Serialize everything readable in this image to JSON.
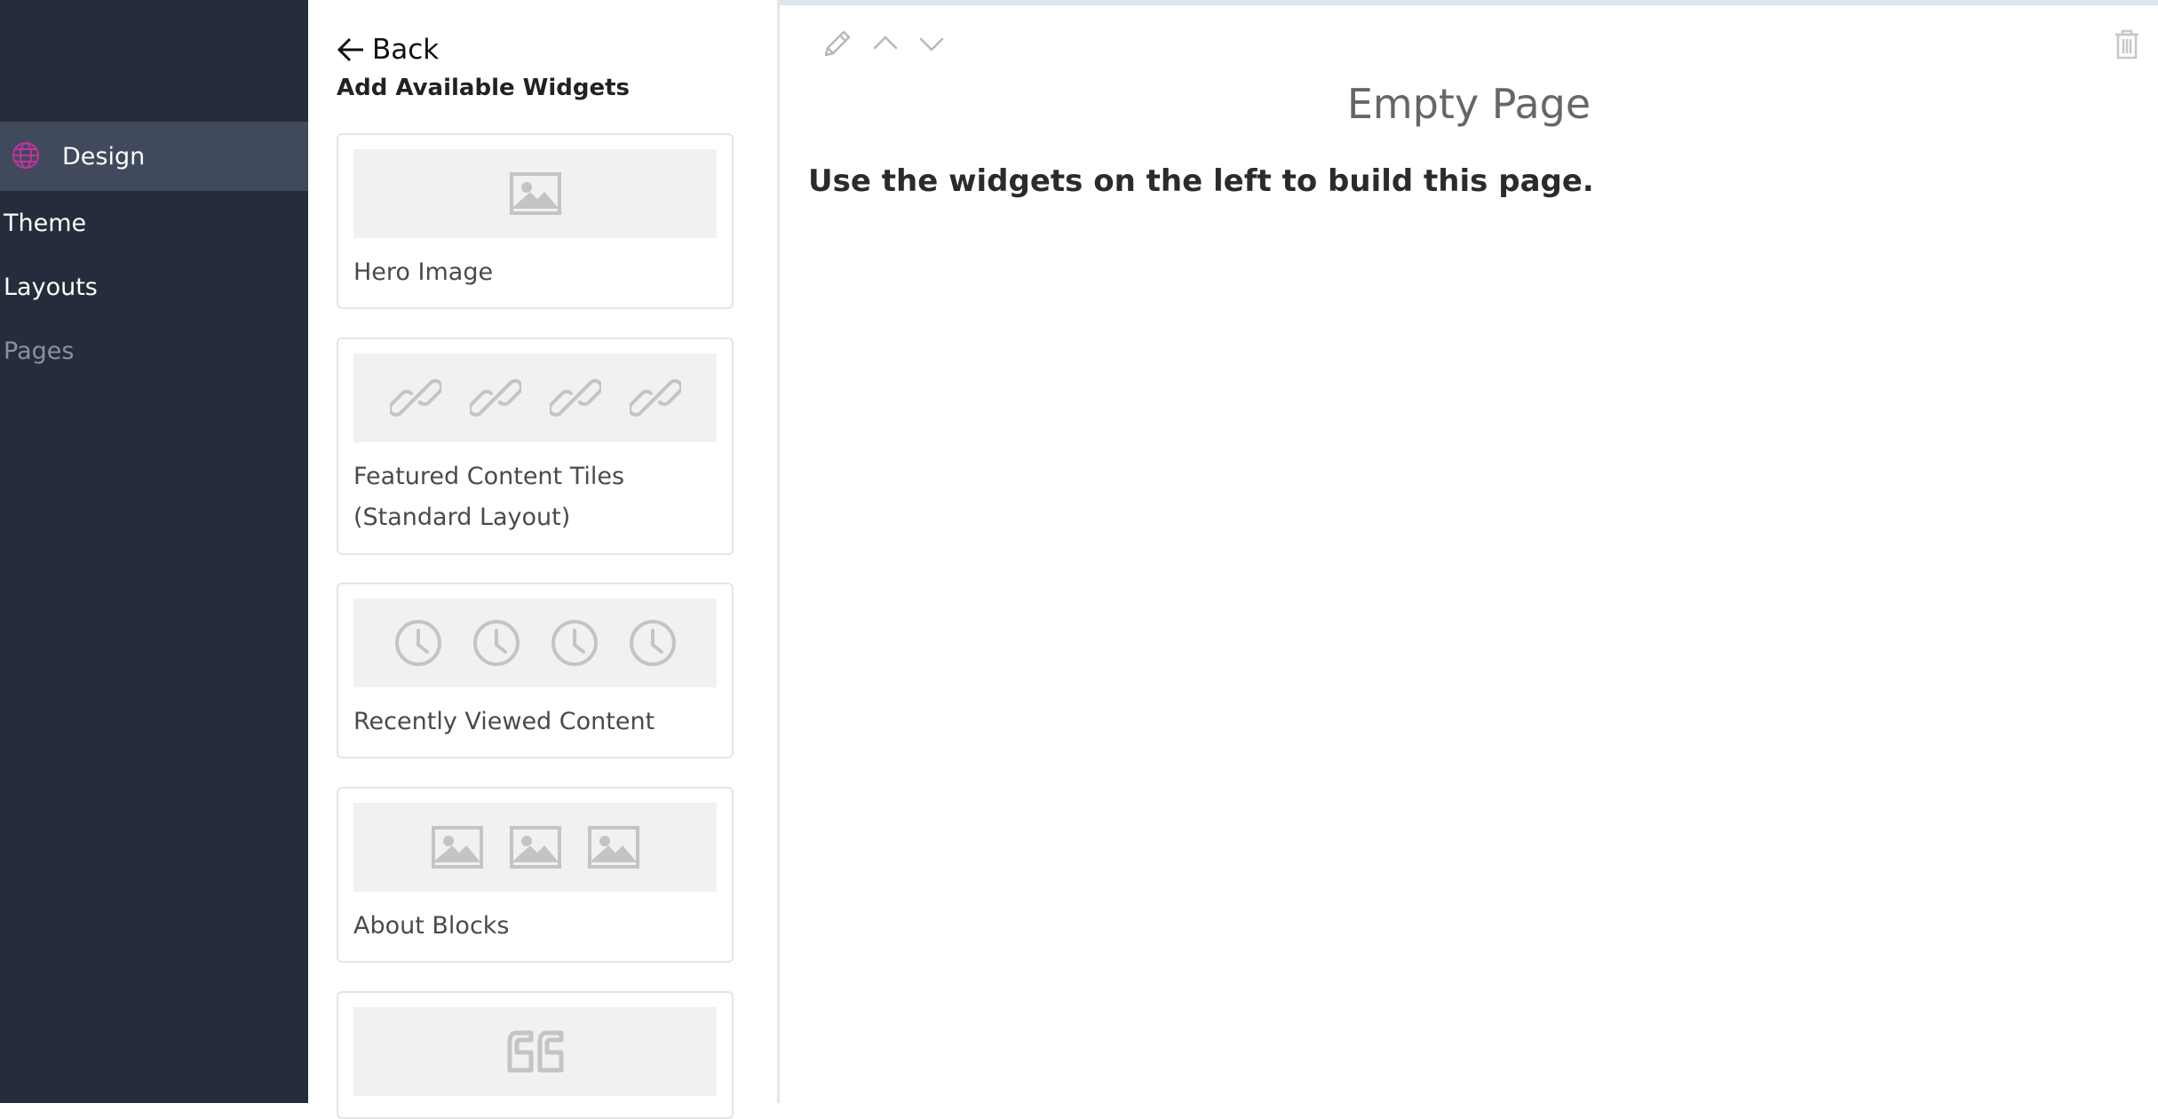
{
  "sidebar": {
    "active_item": {
      "label": "Design",
      "icon": "globe-icon",
      "icon_color": "#c0359f"
    },
    "items": [
      {
        "label": "Theme"
      },
      {
        "label": "Layouts"
      },
      {
        "label": "Pages"
      }
    ]
  },
  "panel": {
    "back_label": "Back",
    "title": "Add Available Widgets",
    "widgets": [
      {
        "label": "Hero Image",
        "icon": "image-icon"
      },
      {
        "label": "Featured Content Tiles (Standard Layout)",
        "icon": "link-icon"
      },
      {
        "label": "Recently Viewed Content",
        "icon": "clock-icon"
      },
      {
        "label": "About Blocks",
        "icon": "image-icon"
      },
      {
        "label": "",
        "icon": "quote-icon"
      }
    ]
  },
  "toolbar": {
    "edit_icon": "pencil-icon",
    "up_icon": "chevron-up-icon",
    "down_icon": "chevron-down-icon",
    "delete_icon": "trash-icon"
  },
  "main": {
    "title": "Empty Page",
    "message": "Use the widgets on the left to build this page."
  },
  "colors": {
    "sidebar_bg": "#252c3b",
    "sidebar_active_bg": "#404a5c",
    "accent": "#c0359f"
  }
}
